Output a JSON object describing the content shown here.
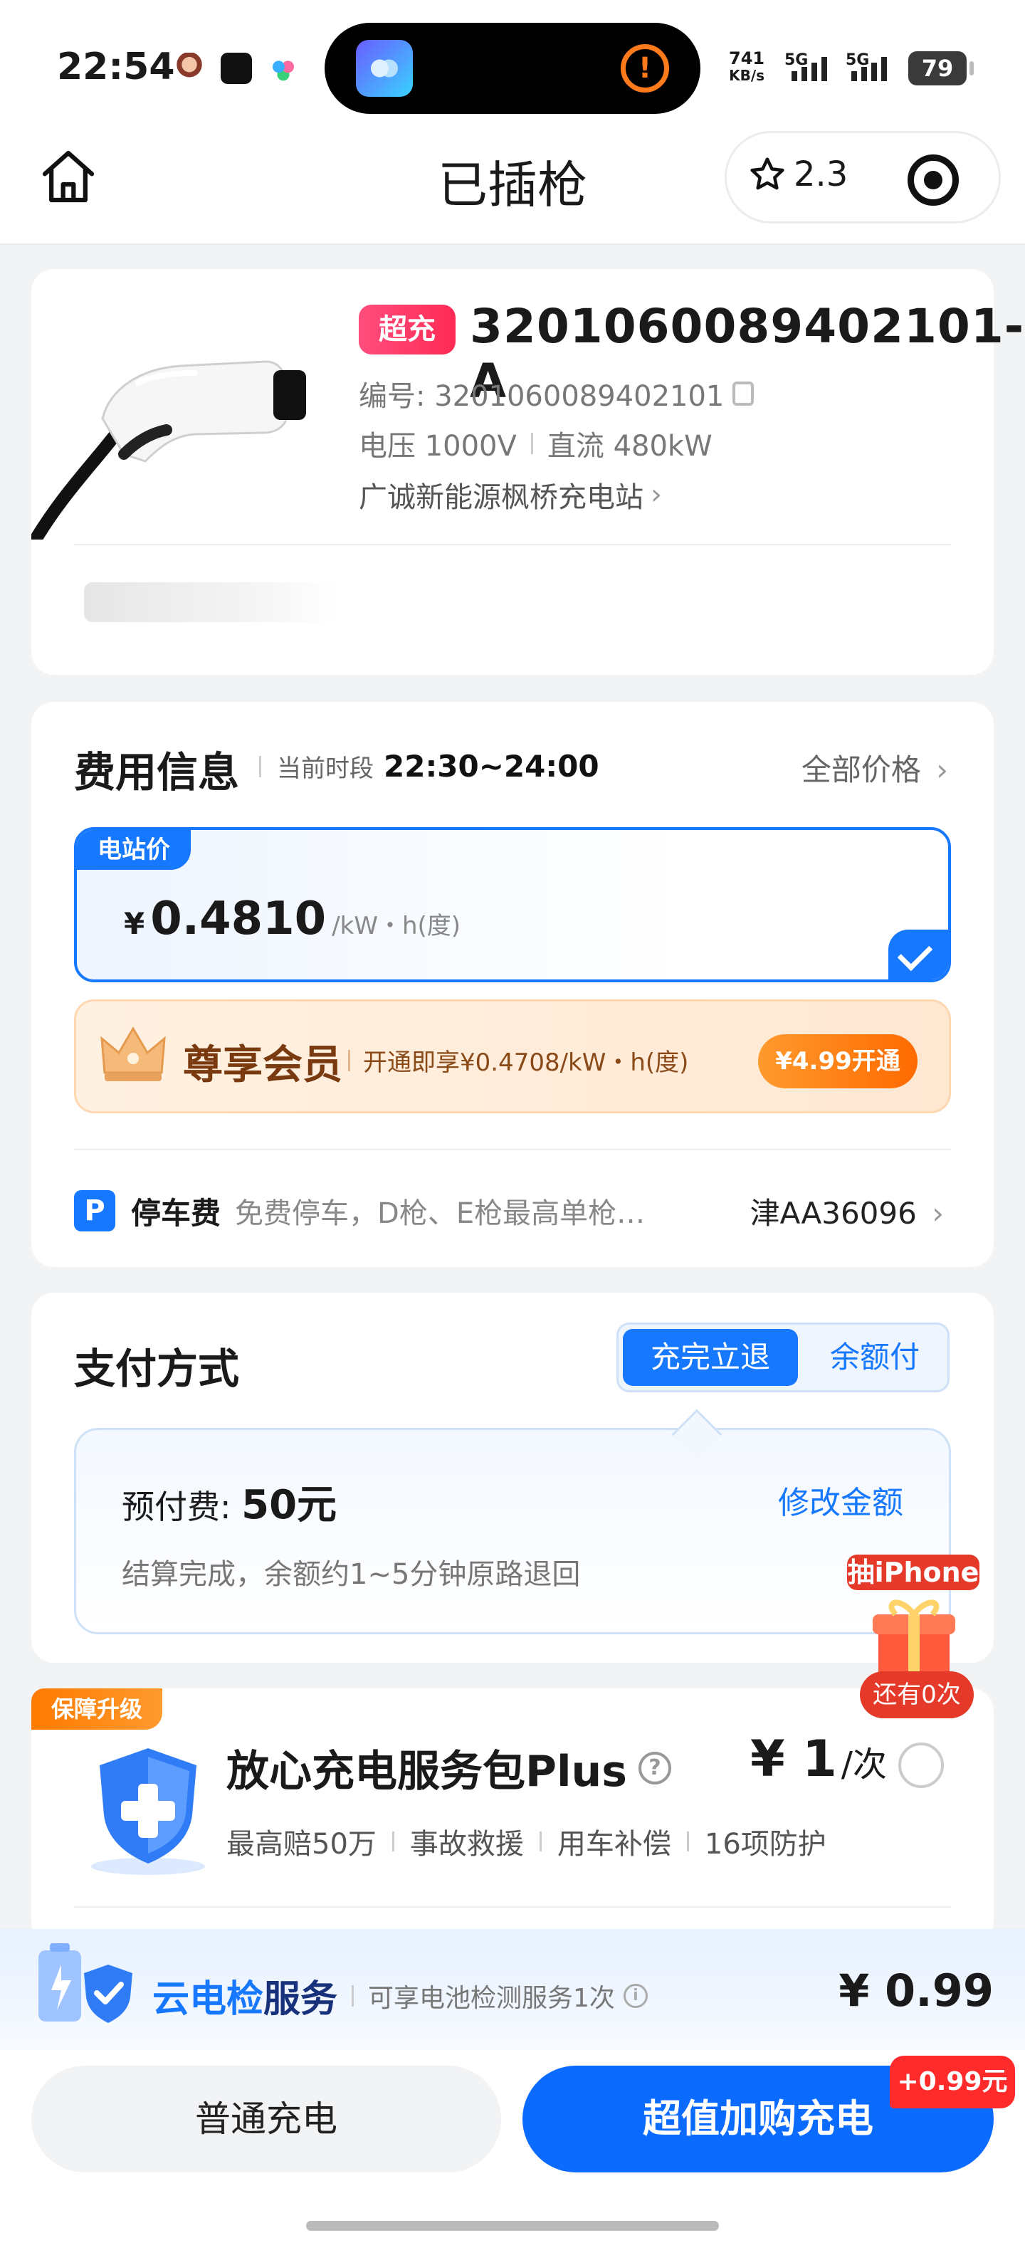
{
  "status_bar": {
    "time": "22:54",
    "net_speed": "741",
    "net_unit": "KB/s",
    "signal_1": "5G",
    "signal_2": "5G",
    "battery": "79"
  },
  "nav": {
    "title": "已插枪",
    "rating": "2.3"
  },
  "station": {
    "badge": "超充",
    "pile_name": "3201060089402101-A",
    "code_label": "编号: 3201060089402101",
    "voltage": "电压 1000V",
    "power": "直流 480kW",
    "station_name": "广诚新能源枫桥充电站",
    "station_chevron": "›"
  },
  "fee": {
    "title": "费用信息",
    "period_label": "当前时段",
    "period": "22:30~24:00",
    "all_prices": "全部价格",
    "chevron": "›",
    "price_tag": "电站价",
    "currency": "¥",
    "price": "0.4810",
    "unit": "/kW・h(度)",
    "vip_title": "尊享会员",
    "vip_desc": "开通即享¥0.4708/kW・h(度)",
    "vip_button": "¥4.99开通",
    "parking_icon": "P",
    "parking_label": "停车费",
    "parking_desc": "免费停车，D枪、E枪最高单枪…",
    "plate": "津AA36096"
  },
  "payment": {
    "title": "支付方式",
    "tab_active": "充完立退",
    "tab_inactive": "余额付",
    "prepay_label": "预付费: ",
    "prepay_amount": "50元",
    "edit": "修改金额",
    "note": "结算完成，余额约1~5分钟原路退回"
  },
  "plus": {
    "tag": "保障升级",
    "title": "放心充电服务包Plus",
    "help": "?",
    "price": "¥ 1",
    "price_unit": "/次",
    "tags": [
      "最高赔50万",
      "事故救援",
      "用车补偿",
      "16项防护"
    ]
  },
  "gift": {
    "label": "抽iPhone",
    "remaining": "还有0次"
  },
  "cloud": {
    "title_a": "云电检",
    "title_b": "服务",
    "desc": "可享电池检测服务1次",
    "info": "i",
    "price": "¥ 0.99"
  },
  "actions": {
    "normal": "普通充电",
    "main": "超值加购充电",
    "extra": "+0.99元"
  },
  "colors": {
    "accent": "#1677ff",
    "vip_orange": "#ff6a00",
    "badge_red": "#ff2a55"
  }
}
